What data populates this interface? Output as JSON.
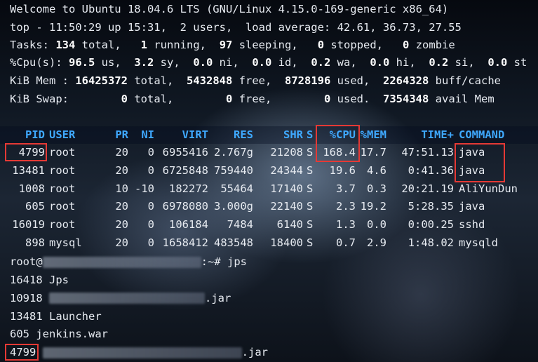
{
  "banner": "Welcome to Ubuntu 18.04.6 LTS (GNU/Linux 4.15.0-169-generic x86_64)",
  "top_line": "top - 11:50:29 up 15:31,  2 users,  load average: 42.61, 36.73, 27.55",
  "tasks": {
    "label": "Tasks:",
    "total": "134",
    "total_l": " total,",
    "running": "1",
    "running_l": " running,",
    "sleeping": "97",
    "sleeping_l": " sleeping,",
    "stopped": "0",
    "stopped_l": " stopped,",
    "zombie": "0",
    "zombie_l": " zombie"
  },
  "cpu": {
    "label": "%Cpu(s):",
    "us": "96.5",
    "us_l": " us,",
    "sy": "3.2",
    "sy_l": " sy,",
    "ni": "0.0",
    "ni_l": " ni,",
    "id": "0.0",
    "id_l": " id,",
    "wa": "0.2",
    "wa_l": " wa,",
    "hi": "0.0",
    "hi_l": " hi,",
    "si": "0.2",
    "si_l": " si,",
    "st": "0.0",
    "st_l": " st"
  },
  "mem": {
    "label": "KiB Mem :",
    "total": "16425372",
    "total_l": " total,",
    "free": "5432848",
    "free_l": " free,",
    "used": "8728196",
    "used_l": " used,",
    "buff": "2264328",
    "buff_l": " buff/cache"
  },
  "swap": {
    "label": "KiB Swap:",
    "total": "0",
    "total_l": " total,",
    "free": "0",
    "free_l": " free,",
    "used": "0",
    "used_l": " used.",
    "avail": "7354348",
    "avail_l": " avail Mem"
  },
  "columns": [
    "PID",
    "USER",
    "PR",
    "NI",
    "VIRT",
    "RES",
    "SHR",
    "S",
    "%CPU",
    "%MEM",
    "TIME+",
    "COMMAND"
  ],
  "processes": [
    [
      "4799",
      "root",
      "20",
      "0",
      "6955416",
      "2.767g",
      "21208",
      "S",
      "168.4",
      "17.7",
      "47:51.13",
      "java"
    ],
    [
      "13481",
      "root",
      "20",
      "0",
      "6725848",
      "759440",
      "24344",
      "S",
      "19.6",
      "4.6",
      "0:41.36",
      "java"
    ],
    [
      "1008",
      "root",
      "10",
      "-10",
      "182272",
      "55464",
      "17140",
      "S",
      "3.7",
      "0.3",
      "20:21.19",
      "AliYunDun"
    ],
    [
      "605",
      "root",
      "20",
      "0",
      "6978080",
      "3.000g",
      "22140",
      "S",
      "2.3",
      "19.2",
      "5:28.35",
      "java"
    ],
    [
      "16019",
      "root",
      "20",
      "0",
      "106184",
      "7484",
      "6140",
      "S",
      "1.3",
      "0.0",
      "0:00.25",
      "sshd"
    ],
    [
      "898",
      "mysql",
      "20",
      "0",
      "1658412",
      "483548",
      "18400",
      "S",
      "0.7",
      "2.9",
      "1:48.02",
      "mysqld"
    ]
  ],
  "prompt": {
    "prefix": "root@",
    "suffix": ":~# ",
    "command": "jps"
  },
  "jps": [
    {
      "pid": "16418",
      "name": "Jps"
    },
    {
      "pid": "10918",
      "name": ".jar"
    },
    {
      "pid": "13481",
      "name": "Launcher"
    },
    {
      "pid": "605",
      "name": "jenkins.war"
    },
    {
      "pid": "4799",
      "name": ".jar"
    }
  ]
}
